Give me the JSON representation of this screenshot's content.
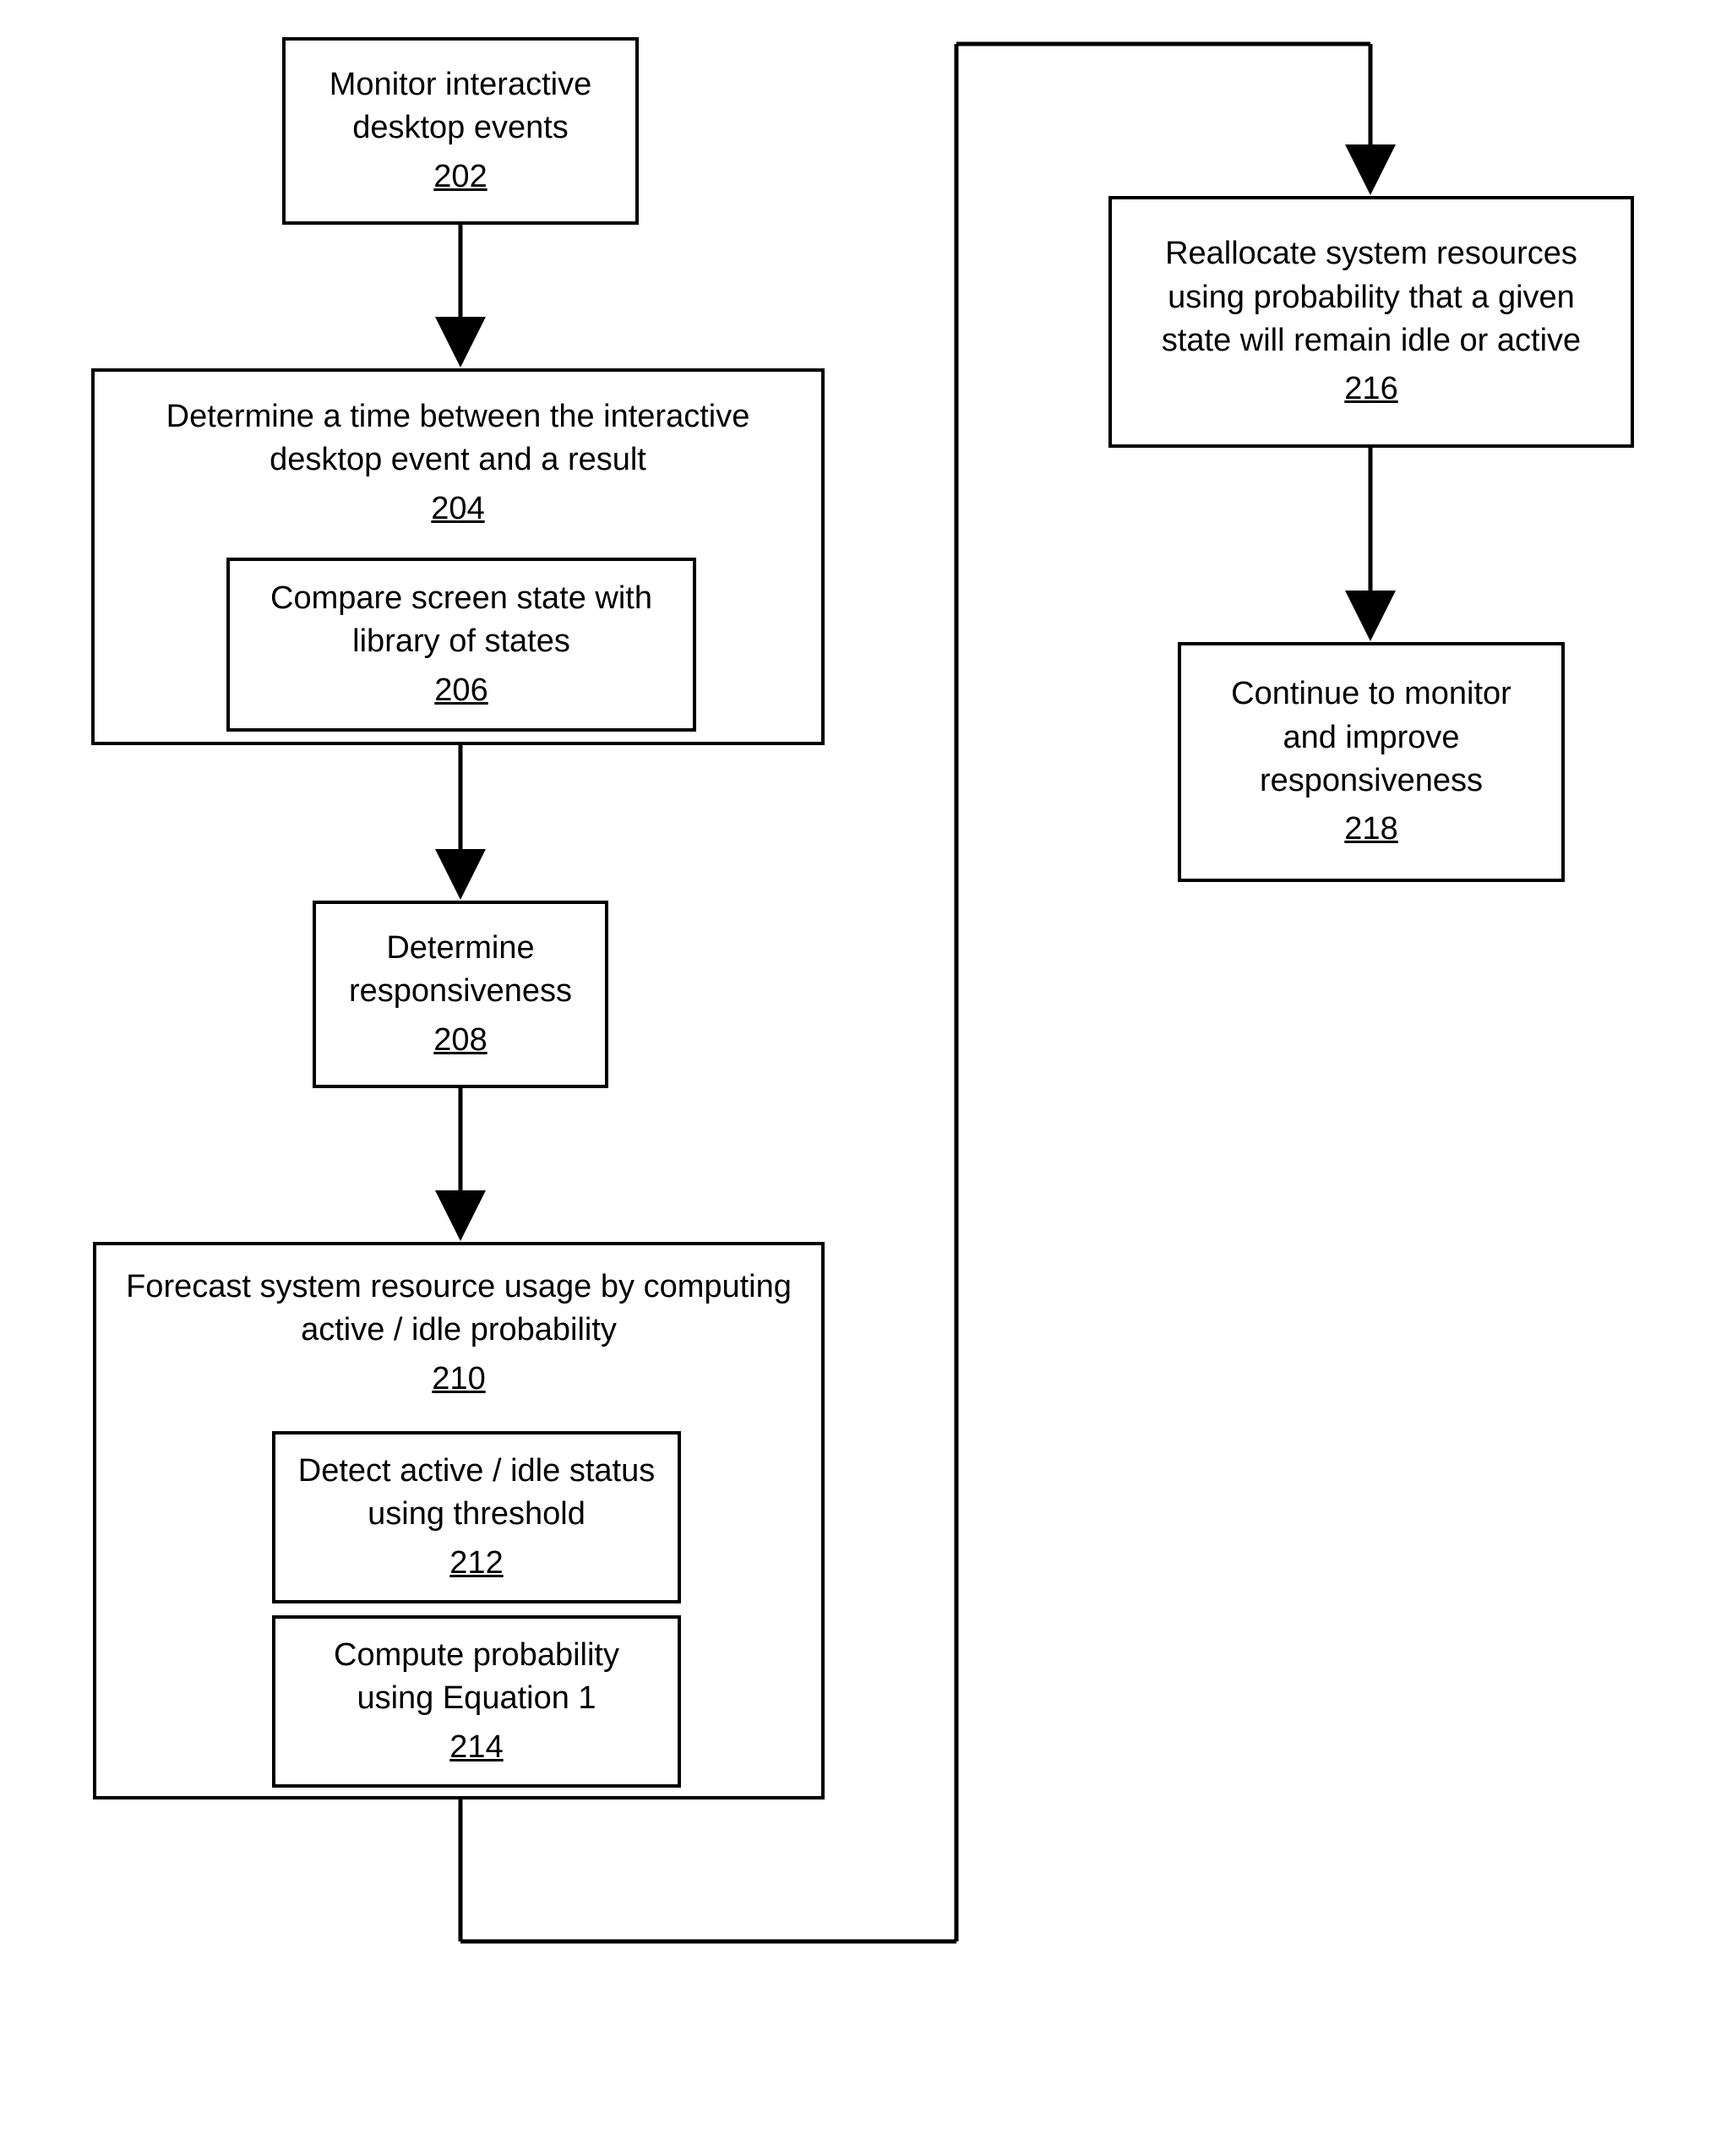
{
  "boxes": {
    "b202": {
      "text": "Monitor interactive desktop events",
      "num": "202"
    },
    "b204": {
      "text": "Determine a time between the interactive desktop event and a result",
      "num": "204"
    },
    "b206": {
      "text": "Compare screen state with library of states",
      "num": "206"
    },
    "b208": {
      "text": "Determine responsiveness",
      "num": "208"
    },
    "b210": {
      "text": "Forecast system resource usage by computing active / idle probability",
      "num": "210"
    },
    "b212": {
      "text": "Detect active / idle status using threshold",
      "num": "212"
    },
    "b214": {
      "text": "Compute probability using Equation 1",
      "num": "214"
    },
    "b216": {
      "text": "Reallocate system resources using probability that a given state will remain idle or active",
      "num": "216"
    },
    "b218": {
      "text": "Continue to monitor and improve responsiveness",
      "num": "218"
    }
  }
}
